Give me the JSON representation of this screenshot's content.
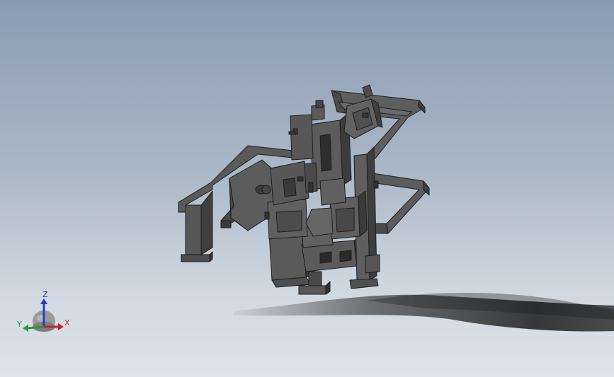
{
  "viewport": {
    "background_top": "#8a9bb2",
    "background_bottom": "#dfe4ea"
  },
  "model": {
    "name_icon": "machine-assembly-model",
    "body_color": "#5a5a5a",
    "edge_color": "#1e1e1e",
    "shadow_color": "#1a1a1a"
  },
  "triad": {
    "x_label": "X",
    "y_label": "Y",
    "z_label": "Z",
    "x_color": "#c0282a",
    "y_color": "#2a9a36",
    "z_color": "#2a3cc0"
  }
}
